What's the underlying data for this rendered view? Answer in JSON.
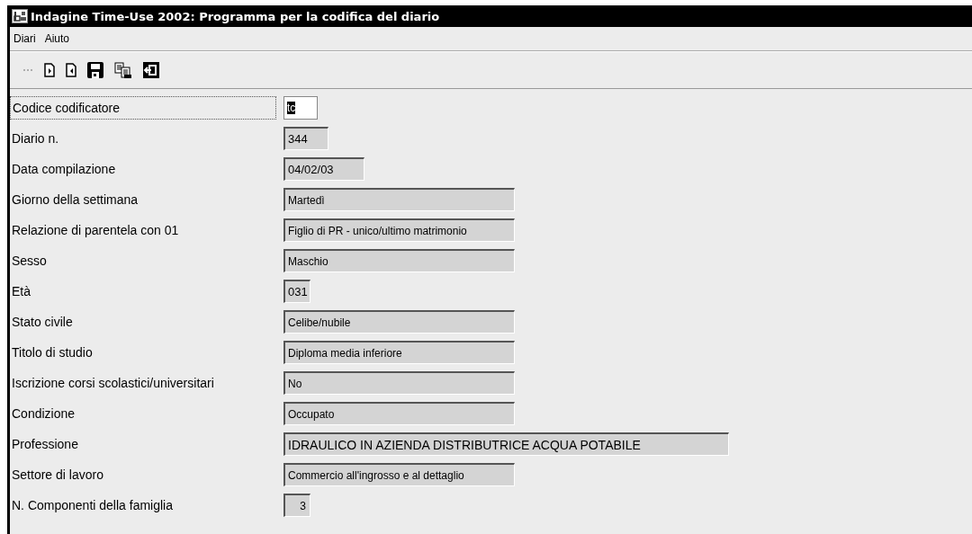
{
  "window": {
    "title": "Indagine Time-Use 2002: Programma per la codifica del diario"
  },
  "menu": [
    "Diari",
    "Aiuto"
  ],
  "form": [
    {
      "label": "Codice codificatore",
      "value": "tc",
      "kind": "focused"
    },
    {
      "label": "Diario n.",
      "value": "344",
      "kind": "readonly"
    },
    {
      "label": "Data compilazione",
      "value": "04/02/03",
      "kind": "readonly"
    },
    {
      "label": "Giorno della settimana",
      "value": "Martedì",
      "kind": "readonly"
    },
    {
      "label": "Relazione di parentela con 01",
      "value": "Figlio di PR - unico/ultimo matrimonio",
      "kind": "readonly"
    },
    {
      "label": "Sesso",
      "value": "Maschio",
      "kind": "readonly"
    },
    {
      "label": "Età",
      "value": "031",
      "kind": "readonly"
    },
    {
      "label": "Stato civile",
      "value": "Celibe/nubile",
      "kind": "readonly"
    },
    {
      "label": "Titolo di studio",
      "value": "Diploma media inferiore",
      "kind": "readonly"
    },
    {
      "label": "Iscrizione corsi scolastici/universitari",
      "value": "No",
      "kind": "readonly"
    },
    {
      "label": "Condizione",
      "value": "Occupato",
      "kind": "readonly"
    },
    {
      "label": "Professione",
      "value": "IDRAULICO IN AZIENDA DISTRIBUTRICE ACQUA POTABILE",
      "kind": "readonly"
    },
    {
      "label": "Settore di lavoro",
      "value": "Commercio all'ingrosso e al dettaglio",
      "kind": "readonly"
    },
    {
      "label": "N. Componenti della famiglia",
      "value": "3",
      "kind": "readonly"
    }
  ]
}
